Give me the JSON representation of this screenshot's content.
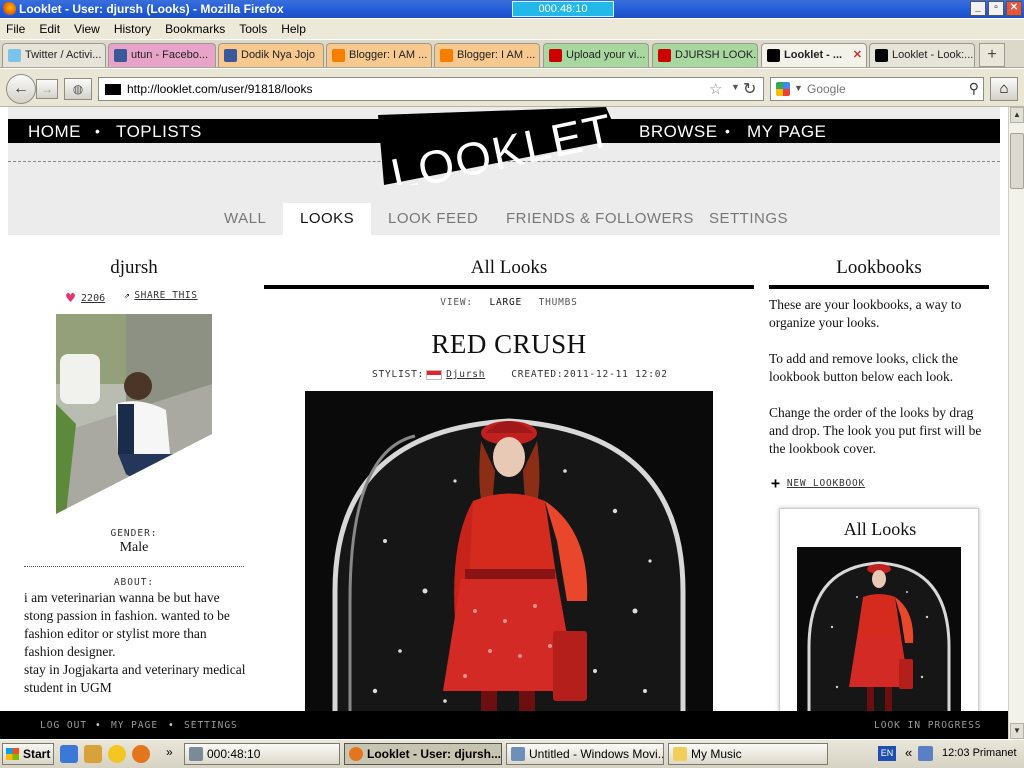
{
  "window": {
    "title": "Looklet - User: djursh (Looks) - Mozilla Firefox",
    "timer": "000:48:10"
  },
  "menu": [
    "File",
    "Edit",
    "View",
    "History",
    "Bookmarks",
    "Tools",
    "Help"
  ],
  "tabs": [
    {
      "label": "Twitter / Activi...",
      "color": "#7cc3ea",
      "tab_bg": "#e6e4d8",
      "active": false
    },
    {
      "label": "utun - Facebo...",
      "color": "#3b5998",
      "tab_bg": "#e8a3c9",
      "active": false
    },
    {
      "label": "Dodik Nya Jojo",
      "color": "#3b5998",
      "tab_bg": "#f7c98f",
      "active": false
    },
    {
      "label": "Blogger: I AM ...",
      "color": "#f57d00",
      "tab_bg": "#f7c98f",
      "active": false
    },
    {
      "label": "Blogger: I AM ...",
      "color": "#f57d00",
      "tab_bg": "#f7c98f",
      "active": false
    },
    {
      "label": "Upload your vi...",
      "color": "#cc0000",
      "tab_bg": "#a8d8a0",
      "active": false
    },
    {
      "label": "DJURSH LOOK...",
      "color": "#cc0000",
      "tab_bg": "#a8d8a0",
      "active": false
    },
    {
      "label": "Looklet - ...",
      "color": "#000000",
      "tab_bg": "#f3f2ea",
      "active": true
    },
    {
      "label": "Looklet - Look:...",
      "color": "#000000",
      "tab_bg": "#e6e4d8",
      "active": false
    }
  ],
  "nav": {
    "url": "http://looklet.com/user/91818/looks",
    "search_placeholder": "Google"
  },
  "site": {
    "top_left": [
      "HOME",
      "TOPLISTS"
    ],
    "top_right": [
      "BROWSE",
      "MY PAGE"
    ],
    "logo_text": "LOOKLET",
    "subnav": [
      "WALL",
      "LOOKS",
      "LOOK FEED",
      "FRIENDS & FOLLOWERS",
      "SETTINGS"
    ],
    "active_subnav": "LOOKS"
  },
  "profile": {
    "username": "djursh",
    "likes": "2206",
    "share_label": "SHARE THIS",
    "gender_label": "GENDER:",
    "gender": "Male",
    "about_label": "ABOUT:",
    "about": "i am veterinarian wanna be but have stong passion in fashion. wanted to be fashion editor or stylist more than fashion designer.\nstay in Jogjakarta and veterinary medical student in UGM"
  },
  "looks": {
    "heading": "All Looks",
    "view_label": "VIEW:",
    "view_options": [
      "LARGE",
      "THUMBS"
    ],
    "look_title": "RED CRUSH",
    "stylist_label": "STYLIST:",
    "stylist": "Djursh",
    "created_label": "CREATED:",
    "created": "2011-12-11 12:02"
  },
  "lookbooks": {
    "heading": "Lookbooks",
    "paragraphs": [
      "These are your lookbooks, a way to organize your looks.",
      "To add and remove looks, click the lookbook button below each look.",
      "Change the order of the looks by drag and drop. The look you put first will be the lookbook cover."
    ],
    "new_label": "NEW LOOKBOOK",
    "card_title": "All Looks"
  },
  "footer": {
    "links": [
      "LOG OUT",
      "MY PAGE",
      "SETTINGS"
    ],
    "status": "LOOK IN PROGRESS"
  },
  "taskbar": {
    "start": "Start",
    "buttons": [
      {
        "label": "000:48:10",
        "active": false
      },
      {
        "label": "Looklet - User: djursh...",
        "active": true
      },
      {
        "label": "Untitled - Windows Movi...",
        "active": false
      },
      {
        "label": "My Music",
        "active": false
      }
    ],
    "lang": "EN",
    "clock": "12:03 Primanet"
  }
}
